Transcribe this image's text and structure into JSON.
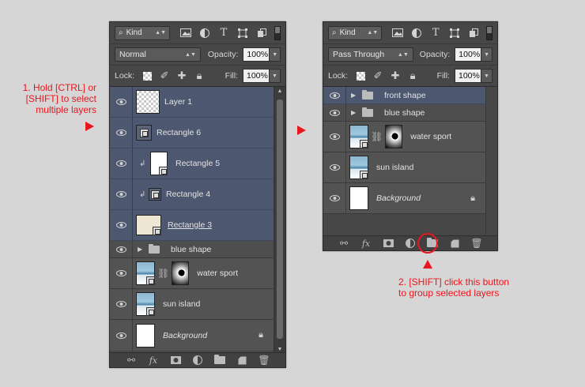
{
  "colors": {
    "annotation": "#e8161d",
    "panel_bg": "#474747",
    "selected_row": "#4d5870"
  },
  "annotations": {
    "left_note_lines": [
      "1. Hold [CTRL] or",
      "[SHIFT] to select",
      "multiple layers"
    ],
    "right_note_lines": [
      "2. [SHIFT] click this button",
      "to group selected layers"
    ]
  },
  "left_panel": {
    "filter": {
      "kind_label": "Kind",
      "search_icon": "search-icon"
    },
    "blend_mode": "Normal",
    "opacity_label": "Opacity:",
    "opacity_value": "100%",
    "lock_label": "Lock:",
    "fill_label": "Fill:",
    "fill_value": "100%",
    "layers": [
      {
        "name": "Layer 1",
        "selected": true,
        "thumb": "checker",
        "italic": false
      },
      {
        "name": "Rectangle 6",
        "selected": true,
        "thumb": "shape",
        "italic": false
      },
      {
        "name": "Rectangle 5",
        "selected": true,
        "thumb": "white-shape",
        "clipped": true,
        "italic": false
      },
      {
        "name": "Rectangle 4",
        "selected": true,
        "thumb": "shape",
        "clipped": true,
        "italic": false
      },
      {
        "name": "Rectangle 3",
        "selected": true,
        "thumb": "cream-shape",
        "underlined": true,
        "italic": false
      },
      {
        "name": "blue shape",
        "group": true
      },
      {
        "name": "water sport",
        "thumb": "photo",
        "mask": true
      },
      {
        "name": "sun island",
        "thumb": "photo"
      },
      {
        "name": "Background",
        "thumb": "white",
        "italic": true,
        "locked": true
      }
    ]
  },
  "right_panel": {
    "filter": {
      "kind_label": "Kind",
      "search_icon": "search-icon"
    },
    "blend_mode": "Pass Through",
    "opacity_label": "Opacity:",
    "opacity_value": "100%",
    "lock_label": "Lock:",
    "fill_label": "Fill:",
    "fill_value": "100%",
    "layers": [
      {
        "name": "front shape",
        "group": true,
        "selected": true
      },
      {
        "name": "blue shape",
        "group": true
      },
      {
        "name": "water sport",
        "thumb": "photo",
        "mask": true
      },
      {
        "name": "sun island",
        "thumb": "photo"
      },
      {
        "name": "Background",
        "thumb": "white",
        "italic": true,
        "locked": true
      }
    ]
  }
}
